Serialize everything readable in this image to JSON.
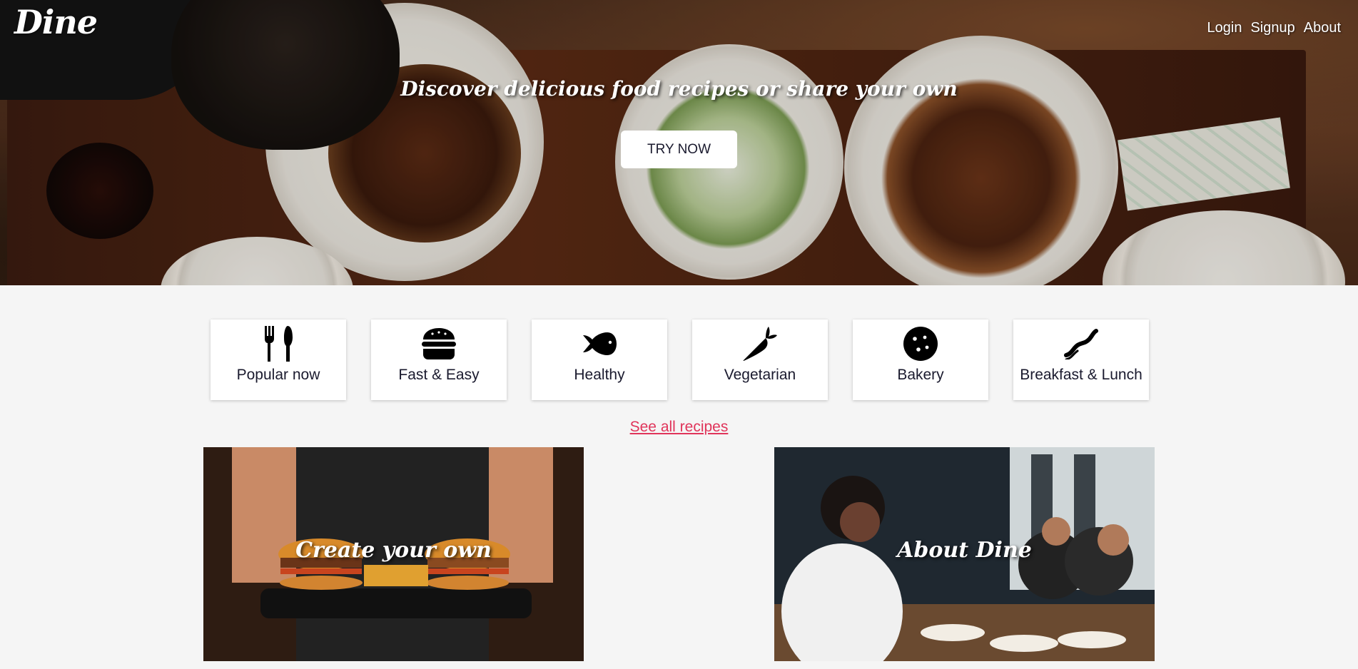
{
  "brand": {
    "logo": "Dine"
  },
  "nav": {
    "login": "Login",
    "signup": "Signup",
    "about": "About"
  },
  "hero": {
    "tagline": "Discover delicious food recipes or share your own",
    "cta": "TRY NOW"
  },
  "categories": [
    {
      "label": "Popular now",
      "icon": "fork-knife-icon"
    },
    {
      "label": "Fast & Easy",
      "icon": "burger-icon"
    },
    {
      "label": "Healthy",
      "icon": "fish-icon"
    },
    {
      "label": "Vegetarian",
      "icon": "carrot-icon"
    },
    {
      "label": "Bakery",
      "icon": "cookie-icon"
    },
    {
      "label": "Breakfast & Lunch",
      "icon": "bacon-icon"
    }
  ],
  "see_all": "See all recipes",
  "features": [
    {
      "title": "Create your own"
    },
    {
      "title": "About Dine"
    }
  ],
  "colors": {
    "accent": "#e0345a",
    "background": "#f5f5f5",
    "text": "#1a1a2e"
  }
}
